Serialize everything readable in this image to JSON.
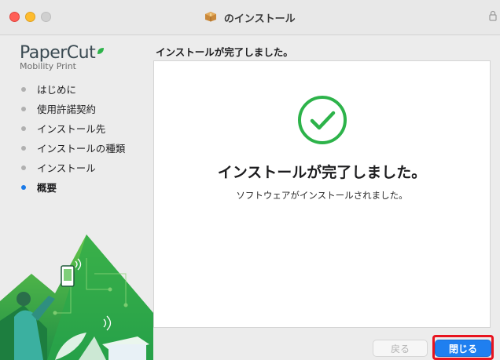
{
  "window": {
    "title": "のインストール"
  },
  "brand": {
    "name": "PaperCut",
    "subtitle": "Mobility Print"
  },
  "sidebar": {
    "steps": [
      {
        "label": "はじめに",
        "active": false
      },
      {
        "label": "使用許諾契約",
        "active": false
      },
      {
        "label": "インストール先",
        "active": false
      },
      {
        "label": "インストールの種類",
        "active": false
      },
      {
        "label": "インストール",
        "active": false
      },
      {
        "label": "概要",
        "active": true
      }
    ]
  },
  "main": {
    "heading": "インストールが完了しました。",
    "done_title": "インストールが完了しました。",
    "done_message": "ソフトウェアがインストールされました。"
  },
  "buttons": {
    "back_label": "戻る",
    "close_label": "閉じる"
  },
  "colors": {
    "accent": "#1f7ff0",
    "success": "#2db34a",
    "highlight": "#e8141f",
    "brand_green": "#2db34a"
  }
}
